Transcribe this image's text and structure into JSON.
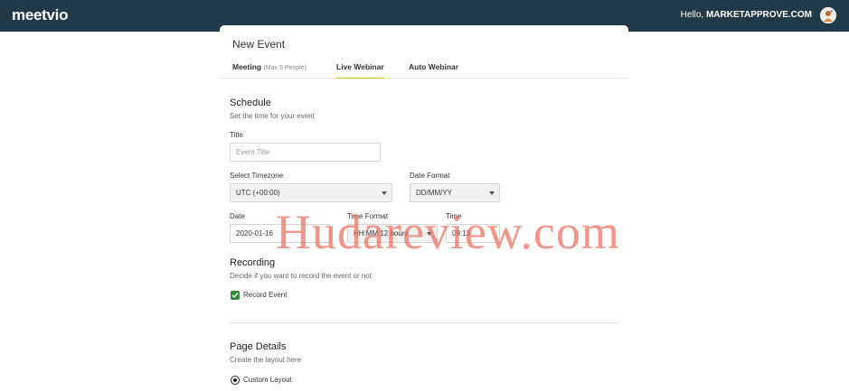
{
  "header": {
    "logo": "meetvio",
    "greeting": "Hello,",
    "username": "MARKETAPPROVE.COM"
  },
  "card": {
    "title": "New Event",
    "tabs": [
      {
        "label": "Meeting",
        "sub": "(Max 5 People)",
        "active": false
      },
      {
        "label": "Live Webinar",
        "active": true
      },
      {
        "label": "Auto Webinar",
        "active": false
      }
    ]
  },
  "schedule": {
    "title": "Schedule",
    "subtitle": "Set the time for your event",
    "title_label": "Title",
    "title_placeholder": "Event Title",
    "timezone_label": "Select Timezone",
    "timezone_value": "UTC (+00:00)",
    "date_format_label": "Date Format",
    "date_format_value": "DD/MM/YY",
    "date_label": "Date",
    "date_value": "2020-01-16",
    "time_format_label": "Time Format",
    "time_format_value": "HH:MM 12 hours",
    "time_label": "Time",
    "time_value": "09:13"
  },
  "recording": {
    "title": "Recording",
    "subtitle": "Decide if you want to record the event or not",
    "checkbox_label": "Record Event",
    "checked": true
  },
  "page_details": {
    "title": "Page Details",
    "subtitle": "Create the layout here",
    "radio_label": "Custom Layout",
    "selected": true
  },
  "watermark": "Hudareview.com",
  "colors": {
    "topbar": "#213a4a",
    "tab_active_underline": "#e6c000",
    "checkbox": "#2e8b3a",
    "watermark": "#ee6e5c"
  }
}
